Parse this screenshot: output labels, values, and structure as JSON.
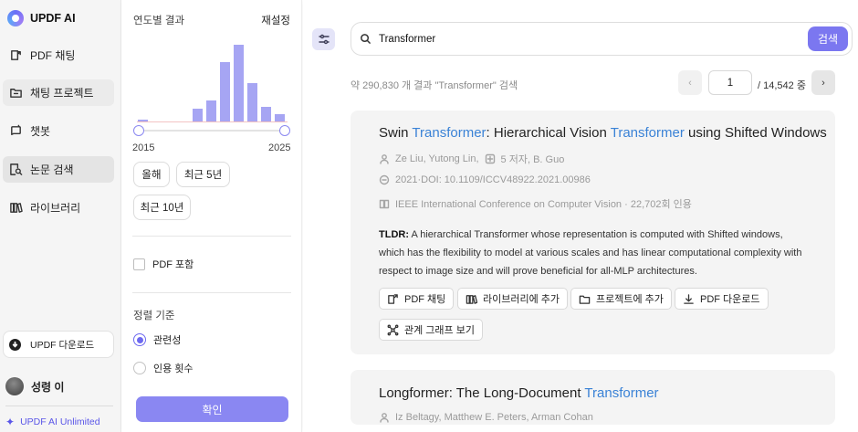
{
  "app": {
    "brand": "UPDF AI"
  },
  "sidebar": {
    "items": [
      {
        "label": "PDF 채팅",
        "icon": "pdf-chat-icon"
      },
      {
        "label": "채팅 프로젝트",
        "icon": "folder-chat-icon"
      },
      {
        "label": "챗봇",
        "icon": "chatbot-icon"
      },
      {
        "label": "논문 검색",
        "icon": "paper-search-icon"
      },
      {
        "label": "라이브러리",
        "icon": "library-icon"
      }
    ],
    "download_label": "UPDF 다운로드",
    "user_name": "성령 이",
    "unlimited_label": "UPDF AI Unlimited"
  },
  "filter": {
    "year_title": "연도별 결과",
    "reset_label": "재설정",
    "histogram_levels": [
      0.04,
      0,
      0,
      0,
      0.18,
      0.28,
      0.78,
      1.0,
      0.51,
      0.2,
      0.11
    ],
    "year_from": "2015",
    "year_to": "2025",
    "chips": [
      "올해",
      "최근 5년",
      "최근 10년"
    ],
    "pdf_include_label": "PDF 포함",
    "sort_title": "정렬 기준",
    "sort_options": [
      "관련성",
      "인용 횟수"
    ],
    "sort_selected": "관련성",
    "confirm_label": "확인"
  },
  "search": {
    "query": "Transformer",
    "button_label": "검색",
    "result_summary": "약 290,830 개 결과 \"Transformer\" 검색"
  },
  "pager": {
    "prev": "‹",
    "current_page": "1",
    "total": "/ 14,542 중",
    "next": "›"
  },
  "results": [
    {
      "title_parts": [
        "Swin ",
        "Transformer",
        ": Hierarchical Vision ",
        "Transformer",
        " using Shifted Windows"
      ],
      "authors": "Ze Liu,  Yutong Lin,  ",
      "more_authors": "5 저자,  B. Guo",
      "doi": "2021·DOI: 10.1109/ICCV48922.2021.00986",
      "venue": "IEEE International Conference on Computer Vision · 22,702회 인용",
      "tldr_label": "TLDR:",
      "tldr": " A hierarchical Transformer whose representation is computed with Shifted windows, which has the flexibility to model at various scales and has linear computational complexity with respect to image size and will prove beneficial for all-MLP architectures.",
      "actions": [
        "PDF 채팅",
        "라이브러리에 추가",
        "프로젝트에 추가",
        "PDF 다운로드",
        "관계 그래프 보기"
      ]
    },
    {
      "title_parts": [
        "Longformer: The Long-Document ",
        "Transformer"
      ],
      "authors": "Iz Beltagy,  Matthew E. Peters,  Arman Cohan"
    }
  ]
}
